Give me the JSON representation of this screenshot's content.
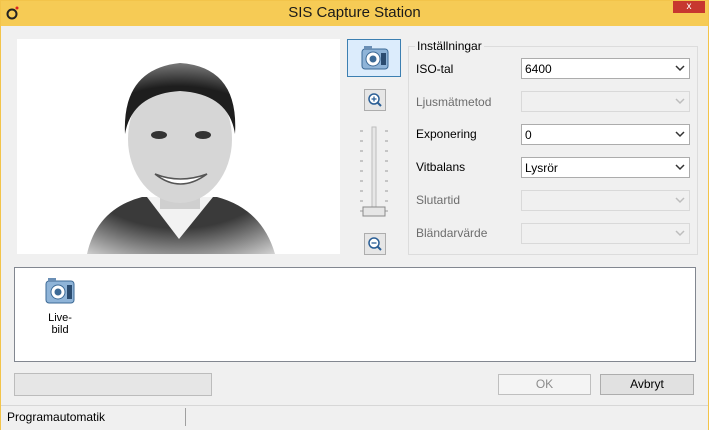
{
  "window": {
    "title": "SIS Capture Station",
    "close_label": "x"
  },
  "toolbar": {
    "camera_icon": "camera-icon",
    "zoom_in_icon": "zoom-in-icon",
    "zoom_out_icon": "zoom-out-icon",
    "zoom_level": 0
  },
  "settings": {
    "title": "Inställningar",
    "rows": [
      {
        "label": "ISO-tal",
        "value": "6400",
        "enabled": true
      },
      {
        "label": "Ljusmätmetod",
        "value": "",
        "enabled": false
      },
      {
        "label": "Exponering",
        "value": "0",
        "enabled": true
      },
      {
        "label": "Vitbalans",
        "value": "Lysrör",
        "enabled": true
      },
      {
        "label": "Slutartid",
        "value": "",
        "enabled": false
      },
      {
        "label": "Bländarvärde",
        "value": "",
        "enabled": false
      }
    ]
  },
  "gallery": {
    "items": [
      {
        "label": "Live-bild",
        "icon": "camera-icon"
      }
    ]
  },
  "buttons": {
    "ok": "OK",
    "cancel": "Avbryt"
  },
  "status": {
    "text": "Programautomatik"
  },
  "colors": {
    "titlebar": "#f6cb55",
    "close": "#c7372f",
    "accent": "#3c7fb1"
  }
}
